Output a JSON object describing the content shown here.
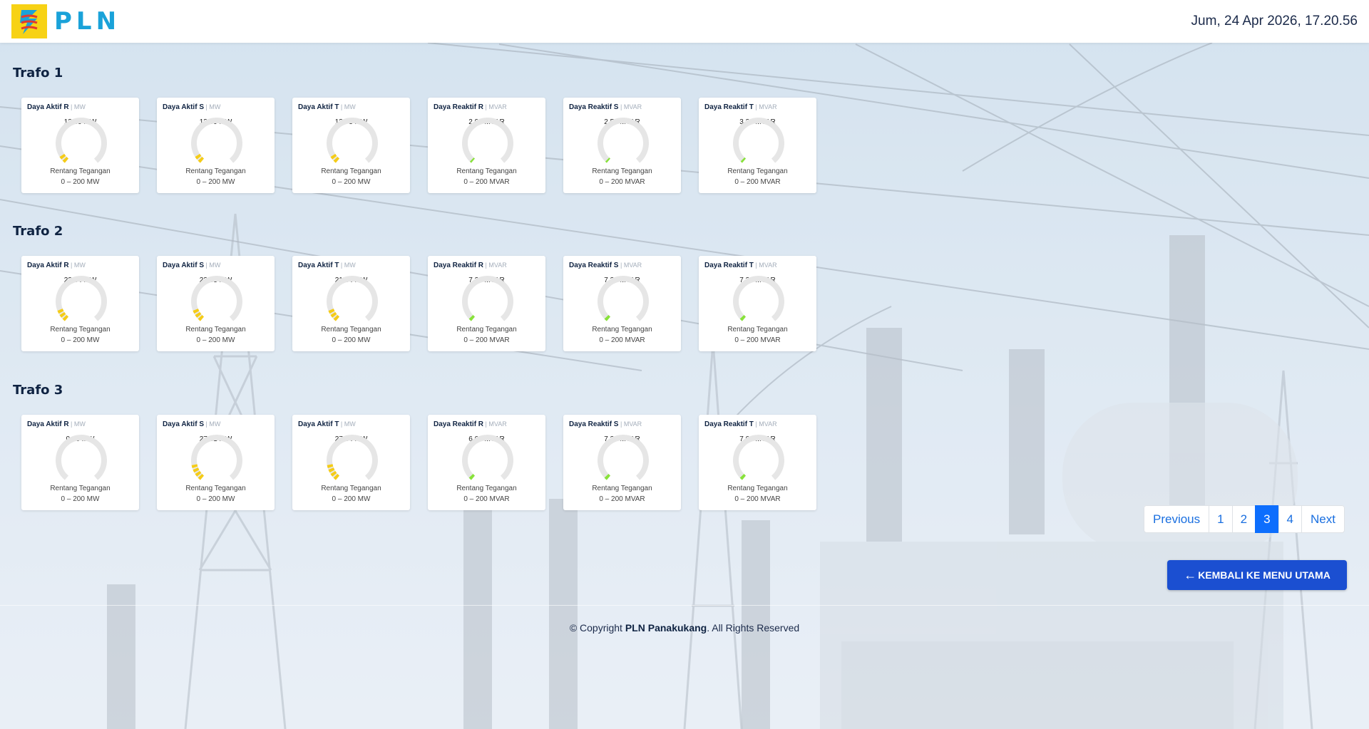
{
  "header": {
    "brand": "PLN",
    "datetime": "Jum, 24 Apr 2026, 17.20.56"
  },
  "sections": [
    {
      "title": "Trafo 1",
      "cards": [
        {
          "name": "Daya Aktif R",
          "unit": "MW",
          "value": "13.69 MW",
          "level": 0.068,
          "color": "#f5cc16",
          "range_label": "Rentang Tegangan",
          "range": "0 – 200 MW"
        },
        {
          "name": "Daya Aktif S",
          "unit": "MW",
          "value": "13.99 MW",
          "level": 0.07,
          "color": "#f5cc16",
          "range_label": "Rentang Tegangan",
          "range": "0 – 200 MW"
        },
        {
          "name": "Daya Aktif T",
          "unit": "MW",
          "value": "13.73 MW",
          "level": 0.069,
          "color": "#f5cc16",
          "range_label": "Rentang Tegangan",
          "range": "0 – 200 MW"
        },
        {
          "name": "Daya Reaktif R",
          "unit": "MVAR",
          "value": "2.91 MVAR",
          "level": 0.015,
          "color": "#88e23a",
          "range_label": "Rentang Tegangan",
          "range": "0 – 200 MVAR"
        },
        {
          "name": "Daya Reaktif S",
          "unit": "MVAR",
          "value": "2.58 MVAR",
          "level": 0.013,
          "color": "#88e23a",
          "range_label": "Rentang Tegangan",
          "range": "0 – 200 MVAR"
        },
        {
          "name": "Daya Reaktif T",
          "unit": "MVAR",
          "value": "3.35 MVAR",
          "level": 0.017,
          "color": "#88e23a",
          "range_label": "Rentang Tegangan",
          "range": "0 – 200 MVAR"
        }
      ]
    },
    {
      "title": "Trafo 2",
      "cards": [
        {
          "name": "Daya Aktif R",
          "unit": "MW",
          "value": "22.64 MW",
          "level": 0.113,
          "color": "#f5cc16",
          "range_label": "Rentang Tegangan",
          "range": "0 – 200 MW"
        },
        {
          "name": "Daya Aktif S",
          "unit": "MW",
          "value": "22.63 MW",
          "level": 0.113,
          "color": "#f5cc16",
          "range_label": "Rentang Tegangan",
          "range": "0 – 200 MW"
        },
        {
          "name": "Daya Aktif T",
          "unit": "MW",
          "value": "21.94 MW",
          "level": 0.11,
          "color": "#f5cc16",
          "range_label": "Rentang Tegangan",
          "range": "0 – 200 MW"
        },
        {
          "name": "Daya Reaktif R",
          "unit": "MVAR",
          "value": "7.20 MVAR",
          "level": 0.036,
          "color": "#88e23a",
          "range_label": "Rentang Tegangan",
          "range": "0 – 200 MVAR"
        },
        {
          "name": "Daya Reaktif S",
          "unit": "MVAR",
          "value": "7.31 MVAR",
          "level": 0.037,
          "color": "#88e23a",
          "range_label": "Rentang Tegangan",
          "range": "0 – 200 MVAR"
        },
        {
          "name": "Daya Reaktif T",
          "unit": "MVAR",
          "value": "7.38 MVAR",
          "level": 0.037,
          "color": "#88e23a",
          "range_label": "Rentang Tegangan",
          "range": "0 – 200 MVAR"
        }
      ]
    },
    {
      "title": "Trafo 3",
      "cards": [
        {
          "name": "Daya Aktif R",
          "unit": "MW",
          "value": "0.00 MW",
          "level": 0.0,
          "color": "#f5cc16",
          "range_label": "Rentang Tegangan",
          "range": "0 – 200 MW"
        },
        {
          "name": "Daya Aktif S",
          "unit": "MW",
          "value": "27.81 MW",
          "level": 0.139,
          "color": "#f5cc16",
          "range_label": "Rentang Tegangan",
          "range": "0 – 200 MW"
        },
        {
          "name": "Daya Aktif T",
          "unit": "MW",
          "value": "27.94 MW",
          "level": 0.14,
          "color": "#f5cc16",
          "range_label": "Rentang Tegangan",
          "range": "0 – 200 MW"
        },
        {
          "name": "Daya Reaktif R",
          "unit": "MVAR",
          "value": "6.00 MVAR",
          "level": 0.03,
          "color": "#88e23a",
          "range_label": "Rentang Tegangan",
          "range": "0 – 200 MVAR"
        },
        {
          "name": "Daya Reaktif S",
          "unit": "MVAR",
          "value": "7.33 MVAR",
          "level": 0.037,
          "color": "#88e23a",
          "range_label": "Rentang Tegangan",
          "range": "0 – 200 MVAR"
        },
        {
          "name": "Daya Reaktif T",
          "unit": "MVAR",
          "value": "7.08 MVAR",
          "level": 0.035,
          "color": "#88e23a",
          "range_label": "Rentang Tegangan",
          "range": "0 – 200 MVAR"
        }
      ]
    }
  ],
  "pagination": {
    "previous": "Previous",
    "pages": [
      "1",
      "2",
      "3",
      "4"
    ],
    "active_page": "3",
    "next": "Next"
  },
  "back_button": {
    "label": "KEMBALI KE MENU UTAMA",
    "icon": "arrow-left-icon"
  },
  "footer": {
    "prefix": "© Copyright",
    "company": "PLN Panakukang",
    "suffix": ". All Rights Reserved"
  },
  "colors": {
    "accent": "#1b4fd1",
    "page_active": "#0d6efd",
    "mw_gauge": "#f5cc16",
    "mvar_gauge": "#88e23a",
    "track": "#e6e6e6"
  }
}
